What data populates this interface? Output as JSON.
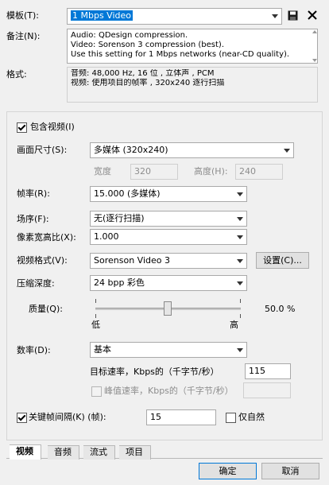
{
  "preset": {
    "label": "模板(T):",
    "value": "1 Mbps Video",
    "save_icon": "save-icon",
    "delete_icon": "close-icon"
  },
  "notes": {
    "label": "备注(N):",
    "lines": [
      "Audio: QDesign compression.",
      "Video: Sorenson 3 compression (best).",
      "Use this setting for 1 Mbps networks (near-CD quality)."
    ]
  },
  "format": {
    "label": "格式:",
    "lines": [
      "音频:   48,000 Hz, 16 位 , 立体声  , PCM",
      "视频:   使用项目的帧率          , 320x240 逐行扫描"
    ]
  },
  "include_video": {
    "label": "包含视频(I)",
    "checked": true
  },
  "frame_size": {
    "label": "画面尺寸(S):",
    "value": "多媒体 (320x240)"
  },
  "width": {
    "label": "宽度",
    "value": "320"
  },
  "height": {
    "label": "高度(H):",
    "value": "240"
  },
  "frame_rate": {
    "label": "帧率(R):",
    "value": "15.000 (多媒体)"
  },
  "field_order": {
    "label": "场序(F):",
    "value": "无(逐行扫描)"
  },
  "pixel_aspect": {
    "label": "像素宽高比(X):",
    "value": "1.000"
  },
  "video_format": {
    "label": "视频格式(V):",
    "value": "Sorenson Video 3",
    "settings_button": "设置(C)..."
  },
  "depth": {
    "label": "压缩深度:",
    "value": "24 bpp 彩色"
  },
  "quality": {
    "label": "质量(Q):",
    "percent_label": "50.0 %",
    "value": 0.5,
    "low_label": "低",
    "high_label": "高"
  },
  "data_rate": {
    "label": "数率(D):",
    "value": "基本"
  },
  "target_rate": {
    "label": "目标速率，Kbps的（千字节/秒）",
    "value": "115"
  },
  "peak_rate": {
    "label": "峰值速率，Kbps的（千字节/秒）",
    "checked": false,
    "value": ""
  },
  "keyframe": {
    "label": "关键帧间隔(K) (帧):",
    "checked": true,
    "value": "15"
  },
  "natural_only": {
    "label": "仅自然",
    "checked": false
  },
  "tabs": [
    "视频",
    "音频",
    "流式",
    "项目"
  ],
  "buttons": {
    "ok": "确定",
    "cancel": "取消"
  }
}
